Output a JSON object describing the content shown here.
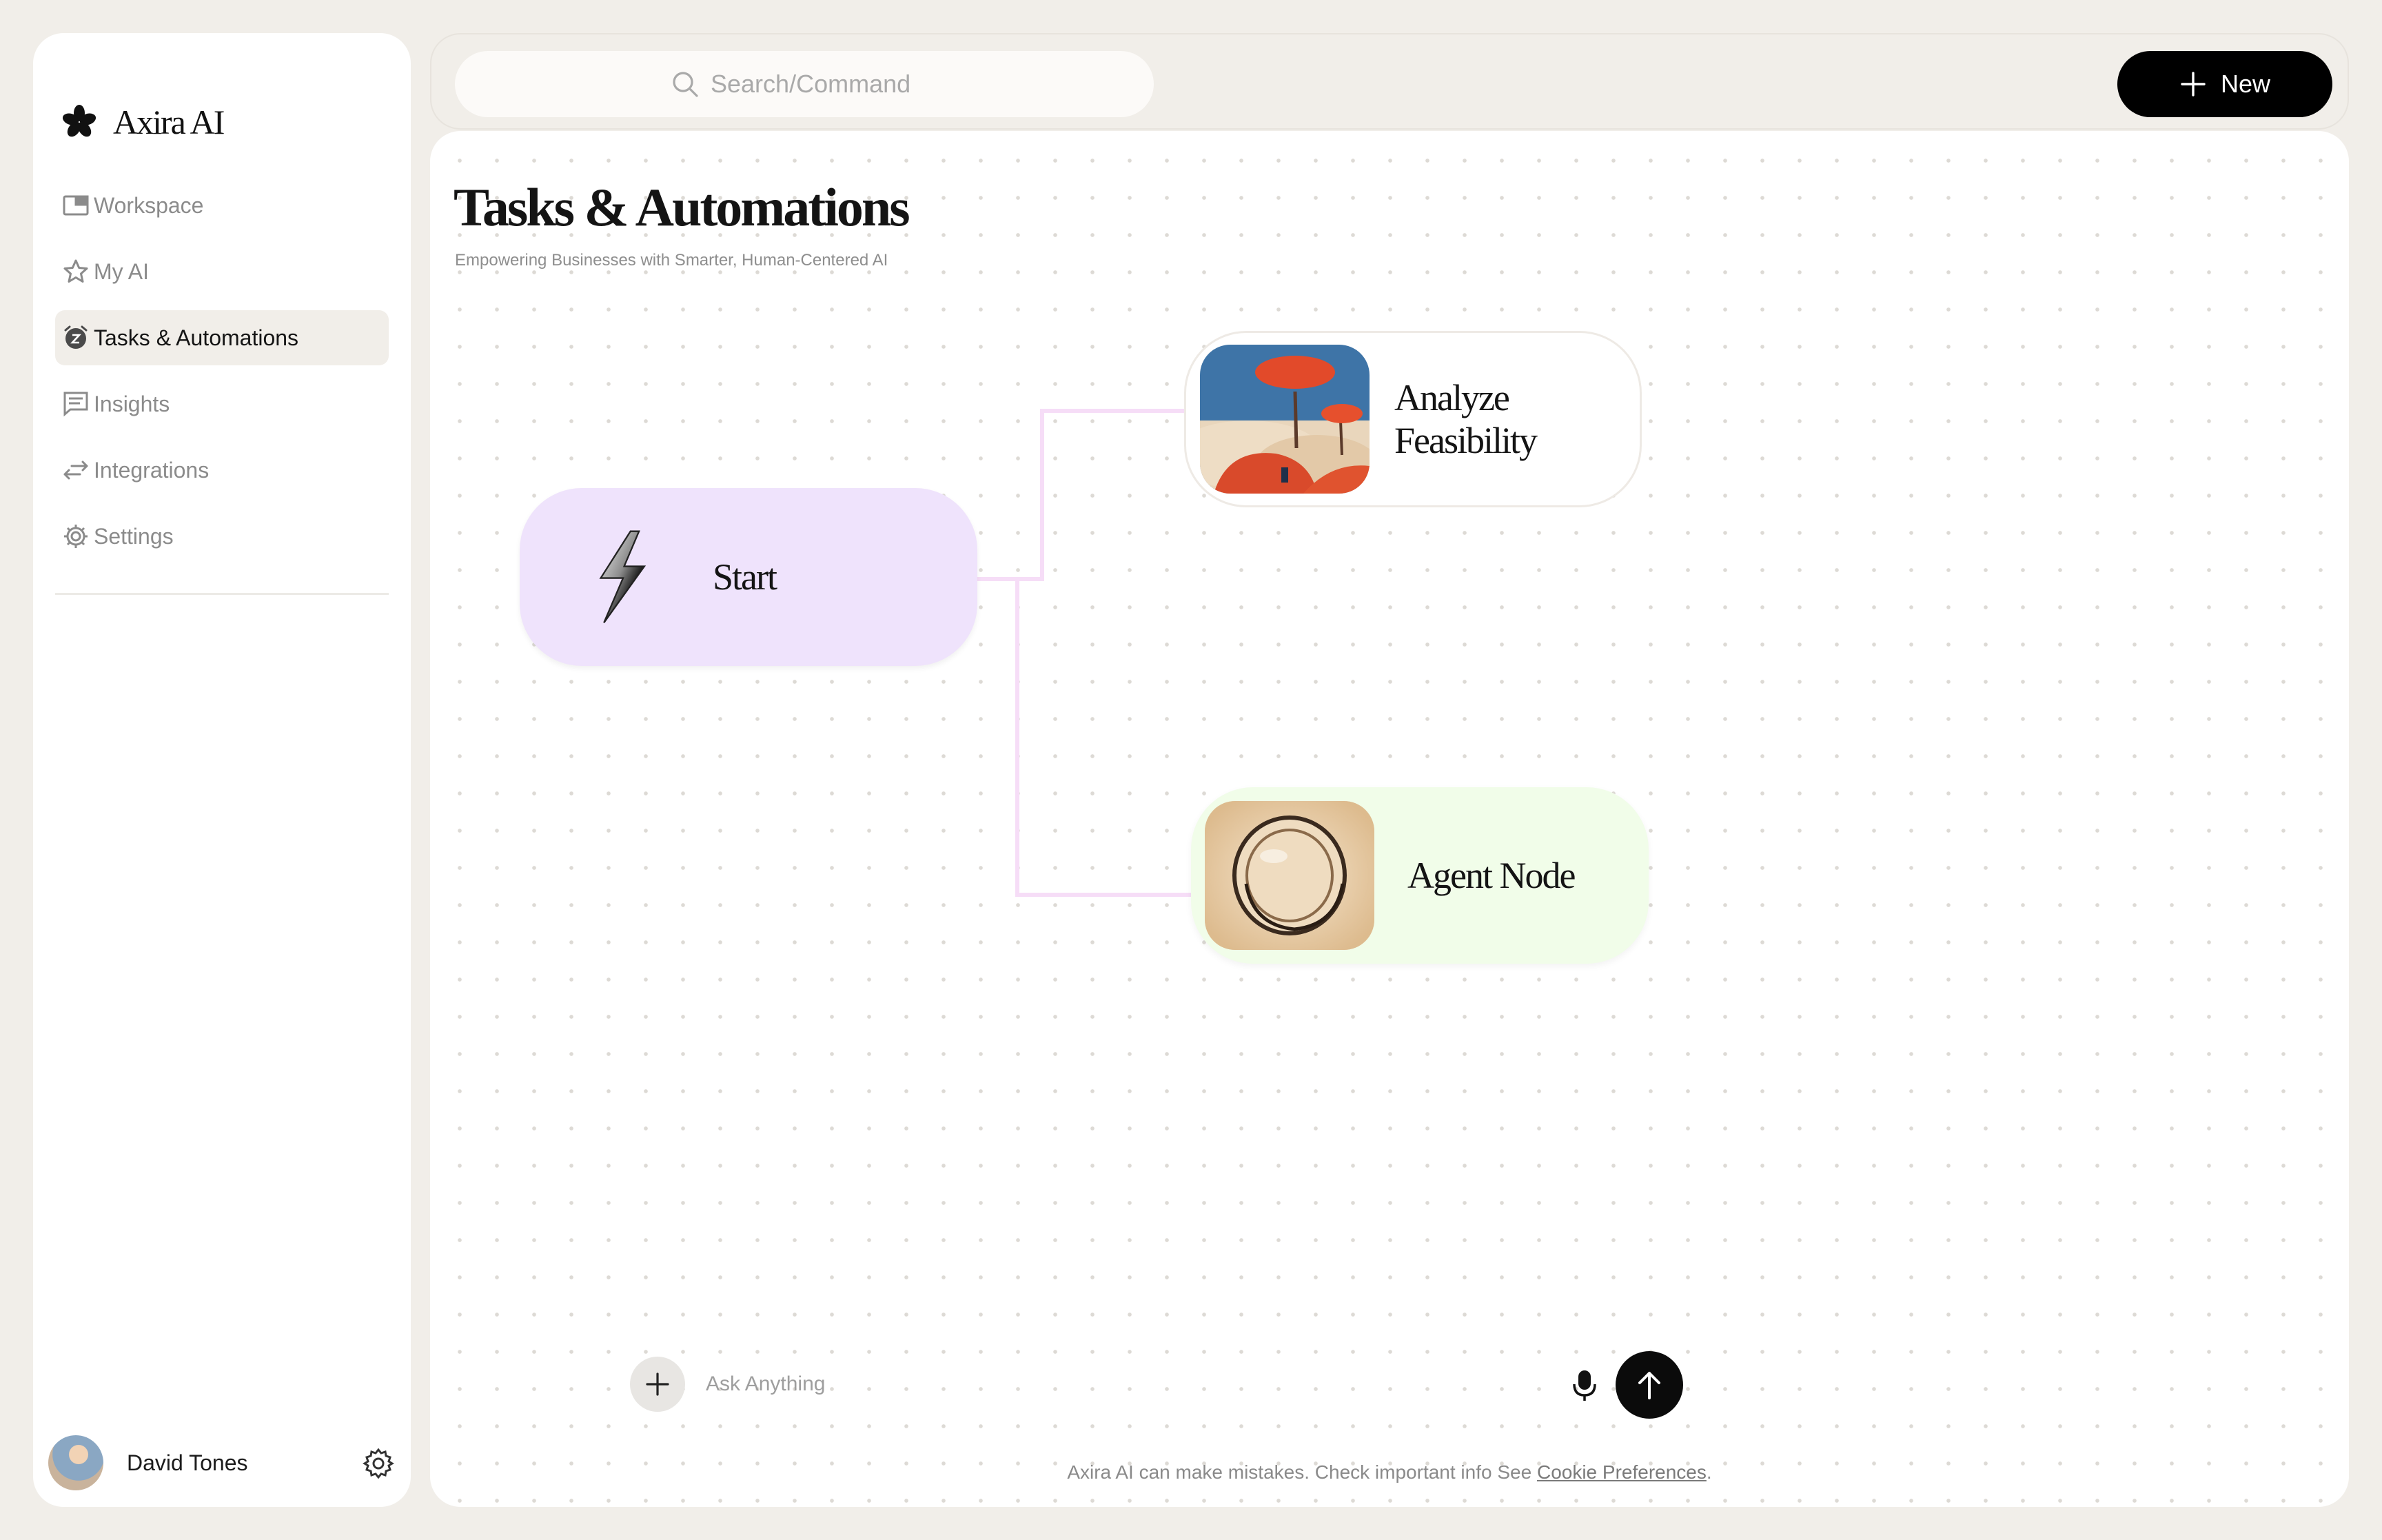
{
  "app": {
    "name": "Axira AI"
  },
  "sidebar": {
    "items": [
      {
        "label": "Workspace",
        "icon": "window-icon"
      },
      {
        "label": "My AI",
        "icon": "star-icon"
      },
      {
        "label": "Tasks & Automations",
        "icon": "alarm-clock-icon",
        "active": true
      },
      {
        "label": "Insights",
        "icon": "message-icon"
      },
      {
        "label": "Integrations",
        "icon": "arrows-swap-icon"
      },
      {
        "label": "Settings",
        "icon": "gear-icon"
      }
    ]
  },
  "user": {
    "name": "David Tones"
  },
  "search": {
    "placeholder": "Search/Command"
  },
  "toolbar": {
    "new_label": "New"
  },
  "page": {
    "title": "Tasks & Automations",
    "subtitle": "Empowering Businesses with Smarter, Human-Centered AI"
  },
  "nodes": {
    "start": {
      "label": "Start"
    },
    "analyze": {
      "label": "Analyze Feasibility"
    },
    "agent": {
      "label": "Agent Node"
    }
  },
  "composer": {
    "placeholder": "Ask Anything"
  },
  "footer": {
    "disclaimer": "Axira AI can make mistakes. Check important info See",
    "link": "Cookie Preferences",
    "trailing": "."
  },
  "colors": {
    "background": "#F1EEE9",
    "start_node": "#EFE3FC",
    "agent_node": "#F1FDE9",
    "connector": "#F6DDF7",
    "primary_button": "#000000"
  }
}
